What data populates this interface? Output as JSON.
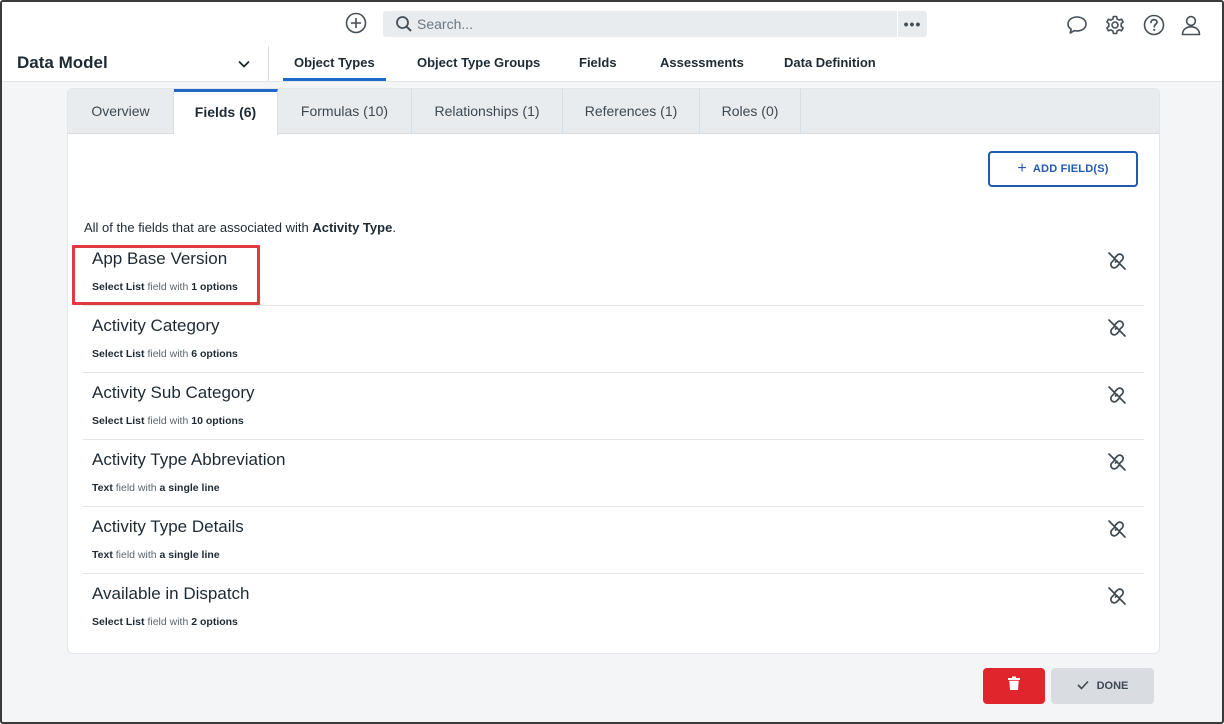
{
  "topbar": {
    "add_icon": "plus-circle-icon",
    "search": {
      "placeholder": "Search...",
      "more_label": "•••"
    },
    "icons": [
      "chat-icon",
      "gear-icon",
      "help-icon",
      "user-icon"
    ]
  },
  "module": {
    "title": "Data Model",
    "icon": "chevron-down-icon"
  },
  "nav": {
    "tabs": [
      {
        "label": "Object Types"
      },
      {
        "label": "Object Type Groups"
      },
      {
        "label": "Fields"
      },
      {
        "label": "Assessments"
      },
      {
        "label": "Data Definition"
      }
    ],
    "active_index": 0
  },
  "card": {
    "tabs": [
      {
        "label": "Overview"
      },
      {
        "label": "Fields (6)"
      },
      {
        "label": "Formulas (10)"
      },
      {
        "label": "Relationships (1)"
      },
      {
        "label": "References (1)"
      },
      {
        "label": "Roles (0)"
      }
    ],
    "active_index": 1,
    "add_button_label": "ADD FIELD(S)",
    "intro_prefix": "All of the fields that are associated with",
    "intro_object": "Activity Type",
    "intro_suffix": ".",
    "fields": [
      {
        "name": "App Base Version",
        "type": "Select List",
        "connector": "field with",
        "detail": "1 options"
      },
      {
        "name": "Activity Category",
        "type": "Select List",
        "connector": "field with",
        "detail": "6 options"
      },
      {
        "name": "Activity Sub Category",
        "type": "Select List",
        "connector": "field with",
        "detail": "10 options"
      },
      {
        "name": "Activity Type Abbreviation",
        "type": "Text",
        "connector": "field with",
        "detail": "a single line"
      },
      {
        "name": "Activity Type Details",
        "type": "Text",
        "connector": "field with",
        "detail": "a single line"
      },
      {
        "name": "Available in Dispatch",
        "type": "Select List",
        "connector": "field with",
        "detail": "2 options"
      }
    ]
  },
  "footer": {
    "delete_icon": "trash-icon",
    "done_icon": "check-icon",
    "done_label": "DONE"
  },
  "colors": {
    "accent": "#1f68c7",
    "danger": "#e0262c",
    "highlight": "#e2383f"
  }
}
